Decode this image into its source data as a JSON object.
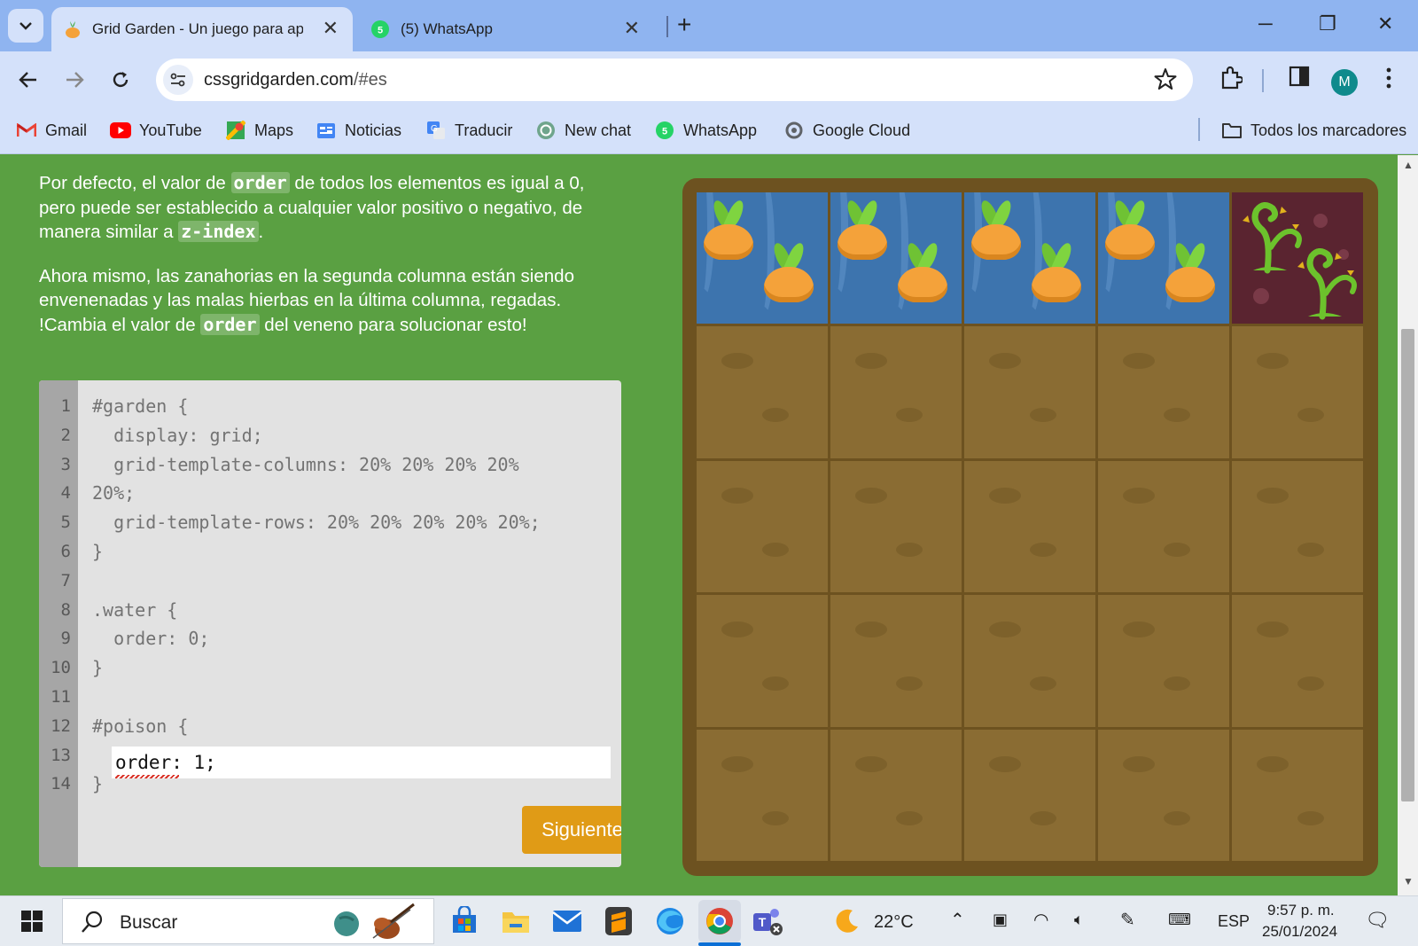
{
  "browser": {
    "tabs": [
      {
        "title": "Grid Garden - Un juego para ap",
        "active": true
      },
      {
        "title": "(5) WhatsApp",
        "active": false,
        "badge": "5"
      }
    ],
    "url_host": "cssgridgarden.com",
    "url_path": "/#es",
    "profile_initial": "M"
  },
  "bookmarks": [
    {
      "label": "Gmail",
      "icon": "gmail-icon"
    },
    {
      "label": "YouTube",
      "icon": "youtube-icon"
    },
    {
      "label": "Maps",
      "icon": "maps-icon"
    },
    {
      "label": "Noticias",
      "icon": "news-icon"
    },
    {
      "label": "Traducir",
      "icon": "translate-icon"
    },
    {
      "label": "New chat",
      "icon": "chatgpt-icon"
    },
    {
      "label": "WhatsApp",
      "icon": "whatsapp-icon"
    },
    {
      "label": "Google Cloud",
      "icon": "google-cloud-icon"
    },
    {
      "label": "Todos los marcadores",
      "icon": "folder-icon"
    }
  ],
  "instructions": {
    "p1_a": "Por defecto, el valor de ",
    "p1_kw1": "order",
    "p1_b": " de todos los elementos es igual a 0, pero puede ser establecido a cualquier valor positivo o negativo, de manera similar a ",
    "p1_kw2": "z-index",
    "p1_c": ".",
    "p2_a": "Ahora mismo, las zanahorias en la segunda columna están siendo envenenadas y las malas hierbas en la última columna, regadas. !Cambia el valor de ",
    "p2_kw": "order",
    "p2_b": " del veneno para solucionar esto!"
  },
  "editor": {
    "line_numbers": [
      "1",
      "2",
      "3",
      "4",
      "5",
      "6",
      "7",
      "8",
      "9",
      "10",
      "11",
      "12",
      "13",
      "14"
    ],
    "lines": [
      "#garden {",
      "  display: grid;",
      "  grid-template-columns: 20% 20% 20% 20%",
      "20%;",
      "  grid-template-rows: 20% 20% 20% 20% 20%;",
      "}",
      "",
      ".water {",
      "  order: 0;",
      "}",
      "",
      "#poison {",
      "",
      "}"
    ],
    "input_value": "order: 1;",
    "next_button": "Siguiente"
  },
  "garden": {
    "rows": 5,
    "columns": 5,
    "first_row": [
      "water-carrots",
      "water-carrots",
      "water-carrots",
      "water-carrots",
      "poison-weeds"
    ]
  },
  "taskbar": {
    "search_label": "Buscar",
    "weather": "22°C",
    "language": "ESP",
    "time": "9:57 p. m.",
    "date": "25/01/2024"
  },
  "colors": {
    "page_bg": "#5aa042",
    "board": "#6d5220",
    "soil": "#8a6c33",
    "water": "#3d74ae",
    "poison": "#5a2430",
    "button": "#e09b16"
  }
}
